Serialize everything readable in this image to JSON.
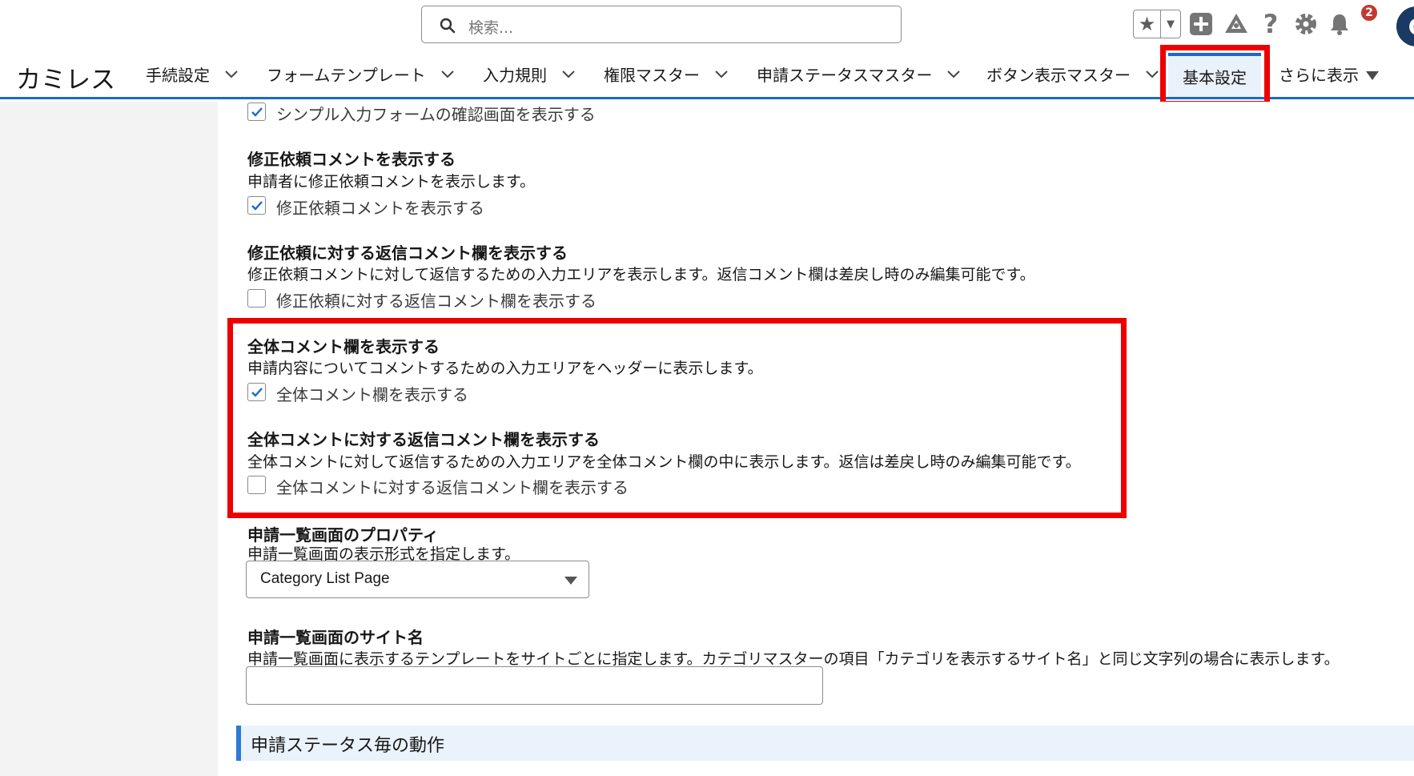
{
  "search": {
    "placeholder": "検索..."
  },
  "header": {
    "notification_count": "2",
    "avatar_initial": "C"
  },
  "nav": {
    "app_name": "カミレス",
    "items": [
      {
        "label": "手続設定"
      },
      {
        "label": "フォームテンプレート"
      },
      {
        "label": "入力規則"
      },
      {
        "label": "権限マスター"
      },
      {
        "label": "申請ステータスマスター"
      },
      {
        "label": "ボタン表示マスター"
      }
    ],
    "active_item": "基本設定",
    "more_label": "さらに表示"
  },
  "settings": {
    "simple_confirm": {
      "checkbox_label": "シンプル入力フォームの確認画面を表示する",
      "checked": true
    },
    "fix_comment": {
      "title": "修正依頼コメントを表示する",
      "description": "申請者に修正依頼コメントを表示します。",
      "checkbox_label": "修正依頼コメントを表示する",
      "checked": true
    },
    "fix_reply": {
      "title": "修正依頼に対する返信コメント欄を表示する",
      "description": "修正依頼コメントに対して返信するための入力エリアを表示します。返信コメント欄は差戻し時のみ編集可能です。",
      "checkbox_label": "修正依頼に対する返信コメント欄を表示する",
      "checked": false
    },
    "overall_comment": {
      "title": "全体コメント欄を表示する",
      "description": "申請内容についてコメントするための入力エリアをヘッダーに表示します。",
      "checkbox_label": "全体コメント欄を表示する",
      "checked": true
    },
    "overall_reply": {
      "title": "全体コメントに対する返信コメント欄を表示する",
      "description": "全体コメントに対して返信するための入力エリアを全体コメント欄の中に表示します。返信は差戻し時のみ編集可能です。",
      "checkbox_label": "全体コメントに対する返信コメント欄を表示する",
      "checked": false
    },
    "list_property": {
      "title": "申請一覧画面のプロパティ",
      "description": "申請一覧画面の表示形式を指定します。",
      "selected": "Category List Page"
    },
    "site_name": {
      "title": "申請一覧画面のサイト名",
      "description": "申請一覧画面に表示するテンプレートをサイトごとに指定します。カテゴリマスターの項目「カテゴリを表示するサイト名」と同じ文字列の場合に表示します。",
      "value": ""
    }
  },
  "section": {
    "title": "申請ステータス毎の動作"
  },
  "colors": {
    "accent": "#1b6ac9",
    "highlight": "#ee0000",
    "checkbox_check": "#1b6ac9"
  }
}
